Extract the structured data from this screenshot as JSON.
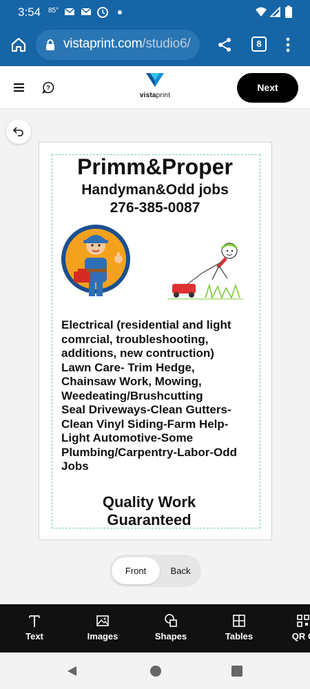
{
  "status_bar": {
    "time": "3:54",
    "temp": "85°"
  },
  "browser": {
    "url_host": "vistaprint.com",
    "url_path": "/studio6/",
    "tab_count": "8"
  },
  "header": {
    "logo_text_bold": "vista",
    "logo_text_rest": "print",
    "next_label": "Next"
  },
  "design": {
    "business_name": "Primm&Proper",
    "subtitle": "Handyman&Odd jobs",
    "phone": "276-385-0087",
    "services_lines": [
      "Electrical (residential and light",
      "comrcial, troubleshooting,",
      "additions, new contruction)",
      "Lawn Care- Trim Hedge,",
      "Chainsaw Work, Mowing,",
      "Weedeating/Brushcutting",
      "Seal Driveways-Clean Gutters-",
      "Clean Vinyl Siding-Farm Help-",
      "Light Automotive-Some",
      "Plumbing/Carpentry-Labor-Odd",
      "Jobs"
    ],
    "quality_line1": "Quality Work",
    "quality_line2": "Guaranteed"
  },
  "side_toggle": {
    "front_label": "Front",
    "back_label": "Back",
    "selected": "Front"
  },
  "toolbar": {
    "items": [
      {
        "label": "Text",
        "icon": "text-icon"
      },
      {
        "label": "Images",
        "icon": "image-icon"
      },
      {
        "label": "Shapes",
        "icon": "shapes-icon"
      },
      {
        "label": "Tables",
        "icon": "table-icon"
      },
      {
        "label": "QR C",
        "icon": "qr-code-icon"
      }
    ]
  },
  "colors": {
    "browser_blue": "#1565a7",
    "accent_black": "#000000",
    "safe_area_dash": "#7fc8c0"
  }
}
